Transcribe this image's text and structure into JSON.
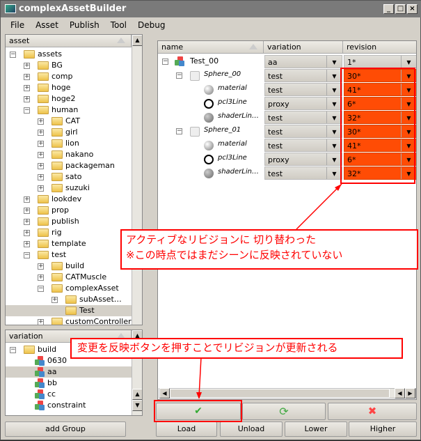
{
  "window": {
    "title": "complexAssetBuilder"
  },
  "menu": [
    "File",
    "Asset",
    "Publish",
    "Tool",
    "Debug"
  ],
  "asset_tree": {
    "header": "asset",
    "items": [
      {
        "label": "assets",
        "level": 0,
        "exp": "-"
      },
      {
        "label": "BG",
        "level": 1,
        "exp": "+"
      },
      {
        "label": "comp",
        "level": 1,
        "exp": "+"
      },
      {
        "label": "hoge",
        "level": 1,
        "exp": "+"
      },
      {
        "label": "hoge2",
        "level": 1,
        "exp": "+"
      },
      {
        "label": "human",
        "level": 1,
        "exp": "-"
      },
      {
        "label": "CAT",
        "level": 2,
        "exp": "+"
      },
      {
        "label": "girl",
        "level": 2,
        "exp": "+"
      },
      {
        "label": "lion",
        "level": 2,
        "exp": "+"
      },
      {
        "label": "nakano",
        "level": 2,
        "exp": "+"
      },
      {
        "label": "packageman",
        "level": 2,
        "exp": "+"
      },
      {
        "label": "sato",
        "level": 2,
        "exp": "+"
      },
      {
        "label": "suzuki",
        "level": 2,
        "exp": "+"
      },
      {
        "label": "lookdev",
        "level": 1,
        "exp": "+"
      },
      {
        "label": "prop",
        "level": 1,
        "exp": "+"
      },
      {
        "label": "publish",
        "level": 1,
        "exp": "+"
      },
      {
        "label": "rig",
        "level": 1,
        "exp": "+"
      },
      {
        "label": "template",
        "level": 1,
        "exp": "+"
      },
      {
        "label": "test",
        "level": 1,
        "exp": "-"
      },
      {
        "label": "build",
        "level": 2,
        "exp": "+"
      },
      {
        "label": "CATMuscle",
        "level": 2,
        "exp": "+"
      },
      {
        "label": "complexAsset",
        "level": 2,
        "exp": "-"
      },
      {
        "label": "subAsset…",
        "level": 3,
        "exp": "+"
      },
      {
        "label": "Test",
        "level": 3,
        "exp": "",
        "selected": true
      },
      {
        "label": "customController",
        "level": 2,
        "exp": "+"
      }
    ]
  },
  "variation_tree": {
    "header": "variation",
    "items": [
      {
        "label": "build",
        "type": "folder"
      },
      {
        "label": "0630",
        "type": "cube"
      },
      {
        "label": "aa",
        "type": "cube",
        "selected": true
      },
      {
        "label": "bb",
        "type": "cube"
      },
      {
        "label": "cc",
        "type": "cube"
      },
      {
        "label": "constraint",
        "type": "cube"
      }
    ]
  },
  "table": {
    "columns": [
      "name",
      "variation",
      "revision"
    ],
    "rows": [
      {
        "name": "Test_00",
        "level": 0,
        "icon": "asset-cube",
        "variation": "aa",
        "revision": "1*",
        "changed": false
      },
      {
        "name": "Sphere_00",
        "level": 1,
        "icon": "lego-brick",
        "variation": "test",
        "revision": "30*",
        "changed": true
      },
      {
        "name": "material",
        "level": 2,
        "icon": "sphere",
        "variation": "test",
        "revision": "41*",
        "changed": true
      },
      {
        "name": "pcl3Line",
        "level": 2,
        "icon": "clock",
        "variation": "proxy",
        "revision": "6*",
        "changed": true
      },
      {
        "name": "shaderLin…",
        "level": 2,
        "icon": "shader",
        "variation": "test",
        "revision": "32*",
        "changed": true
      },
      {
        "name": "Sphere_01",
        "level": 1,
        "icon": "lego-brick",
        "variation": "test",
        "revision": "30*",
        "changed": true
      },
      {
        "name": "material",
        "level": 2,
        "icon": "sphere",
        "variation": "test",
        "revision": "41*",
        "changed": true
      },
      {
        "name": "pcl3Line",
        "level": 2,
        "icon": "clock",
        "variation": "proxy",
        "revision": "6*",
        "changed": true
      },
      {
        "name": "shaderLin…",
        "level": 2,
        "icon": "shader",
        "variation": "test",
        "revision": "32*",
        "changed": true
      }
    ]
  },
  "buttons": {
    "add_group": "add Group",
    "load": "Load",
    "unload": "Unload",
    "lower": "Lower",
    "higher": "Higher",
    "apply": "✔",
    "refresh": "⟳",
    "cancel": "✖"
  },
  "annotations": {
    "top": [
      "アクティブなリビジョンに 切り替わった",
      "※この時点ではまだシーンに反映されていない"
    ],
    "bottom": "変更を反映ボタンを押すことでリビジョンが更新される"
  },
  "colors": {
    "changed_revision": "#ff4c05",
    "annotation": "#ff0000"
  }
}
